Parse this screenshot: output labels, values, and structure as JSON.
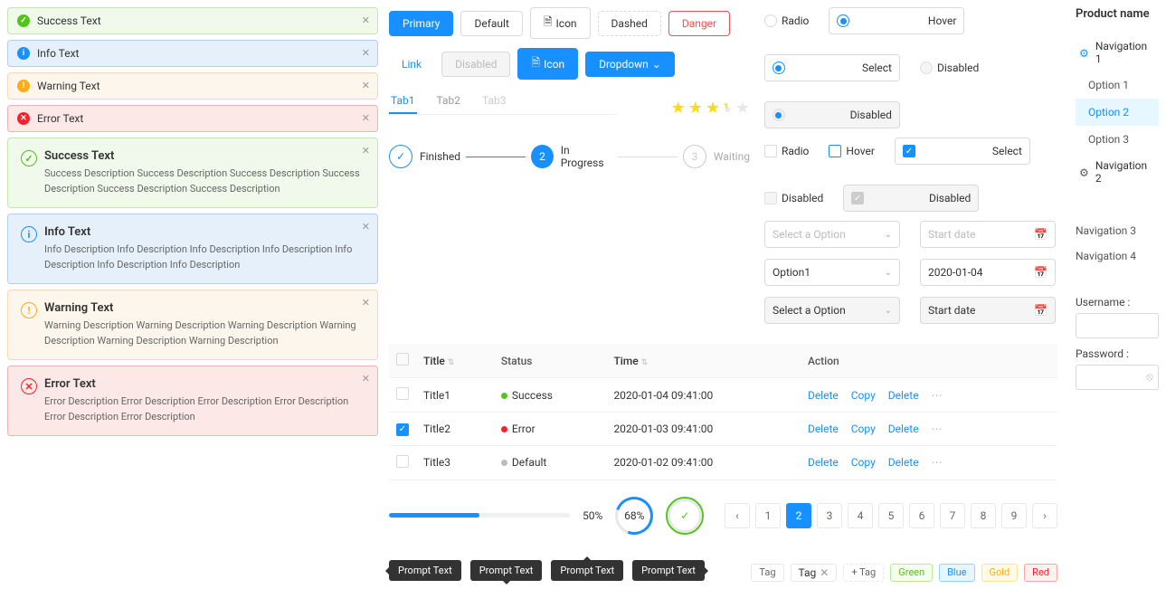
{
  "alerts": {
    "s1": "Success Text",
    "i1": "Info Text",
    "w1": "Warning Text",
    "e1": "Error Text",
    "sd": "Success Description Success Description Success Description Success Description Success Description Success Description",
    "id": "Info Description Info Description Info Description Info Description Info Description Info Description Info Description",
    "wd": "Warning Description Warning Description Warning Description Warning Description Warning Description Warning Description",
    "ed": "Error Description Error Description Error Description Error Description Error Description Error Description"
  },
  "buttons": {
    "primary": "Primary",
    "default": "Default",
    "icon": "Icon",
    "dashed": "Dashed",
    "danger": "Danger",
    "link": "Link",
    "disabled": "Disabled",
    "dropdown": "Dropdown"
  },
  "tabs": {
    "t1": "Tab1",
    "t2": "Tab2",
    "t3": "Tab3"
  },
  "steps": {
    "s1": "Finished",
    "s2": "In Progress",
    "s3": "Waiting",
    "n2": "2",
    "n3": "3"
  },
  "radios": {
    "r": "Radio",
    "h": "Hover",
    "s": "Select",
    "d": "Disabled"
  },
  "selects": {
    "ph": "Select a Option",
    "sd": "Start date",
    "opt1": "Option1",
    "date": "2020-01-04"
  },
  "table": {
    "h": {
      "title": "Title",
      "status": "Status",
      "time": "Time",
      "action": "Action"
    },
    "rows": [
      {
        "title": "Title1",
        "status": "Success",
        "time": "2020-01-04  09:41:00"
      },
      {
        "title": "Title2",
        "status": "Error",
        "time": "2020-01-03  09:41:00"
      },
      {
        "title": "Title3",
        "status": "Default",
        "time": "2020-01-02  09:41:00"
      }
    ],
    "act": {
      "del": "Delete",
      "copy": "Copy"
    }
  },
  "progress": {
    "p50": "50%",
    "p68": "68%",
    "check": "✓"
  },
  "pager": {
    "pages": [
      "1",
      "2",
      "3",
      "4",
      "5",
      "6",
      "7",
      "8",
      "9"
    ]
  },
  "tip": "Prompt Text",
  "tags": {
    "tag": "Tag",
    "new": "+  Tag",
    "g": "Green",
    "b": "Blue",
    "go": "Gold",
    "r": "Red"
  },
  "side": {
    "title": "Product name",
    "n1": "Navigation 1",
    "o1": "Option 1",
    "o2": "Option 2",
    "o3": "Option 3",
    "n2": "Navigation 2",
    "n3": "Navigation 3",
    "n4": "Navigation 4",
    "user": "Username :",
    "pass": "Password :"
  }
}
